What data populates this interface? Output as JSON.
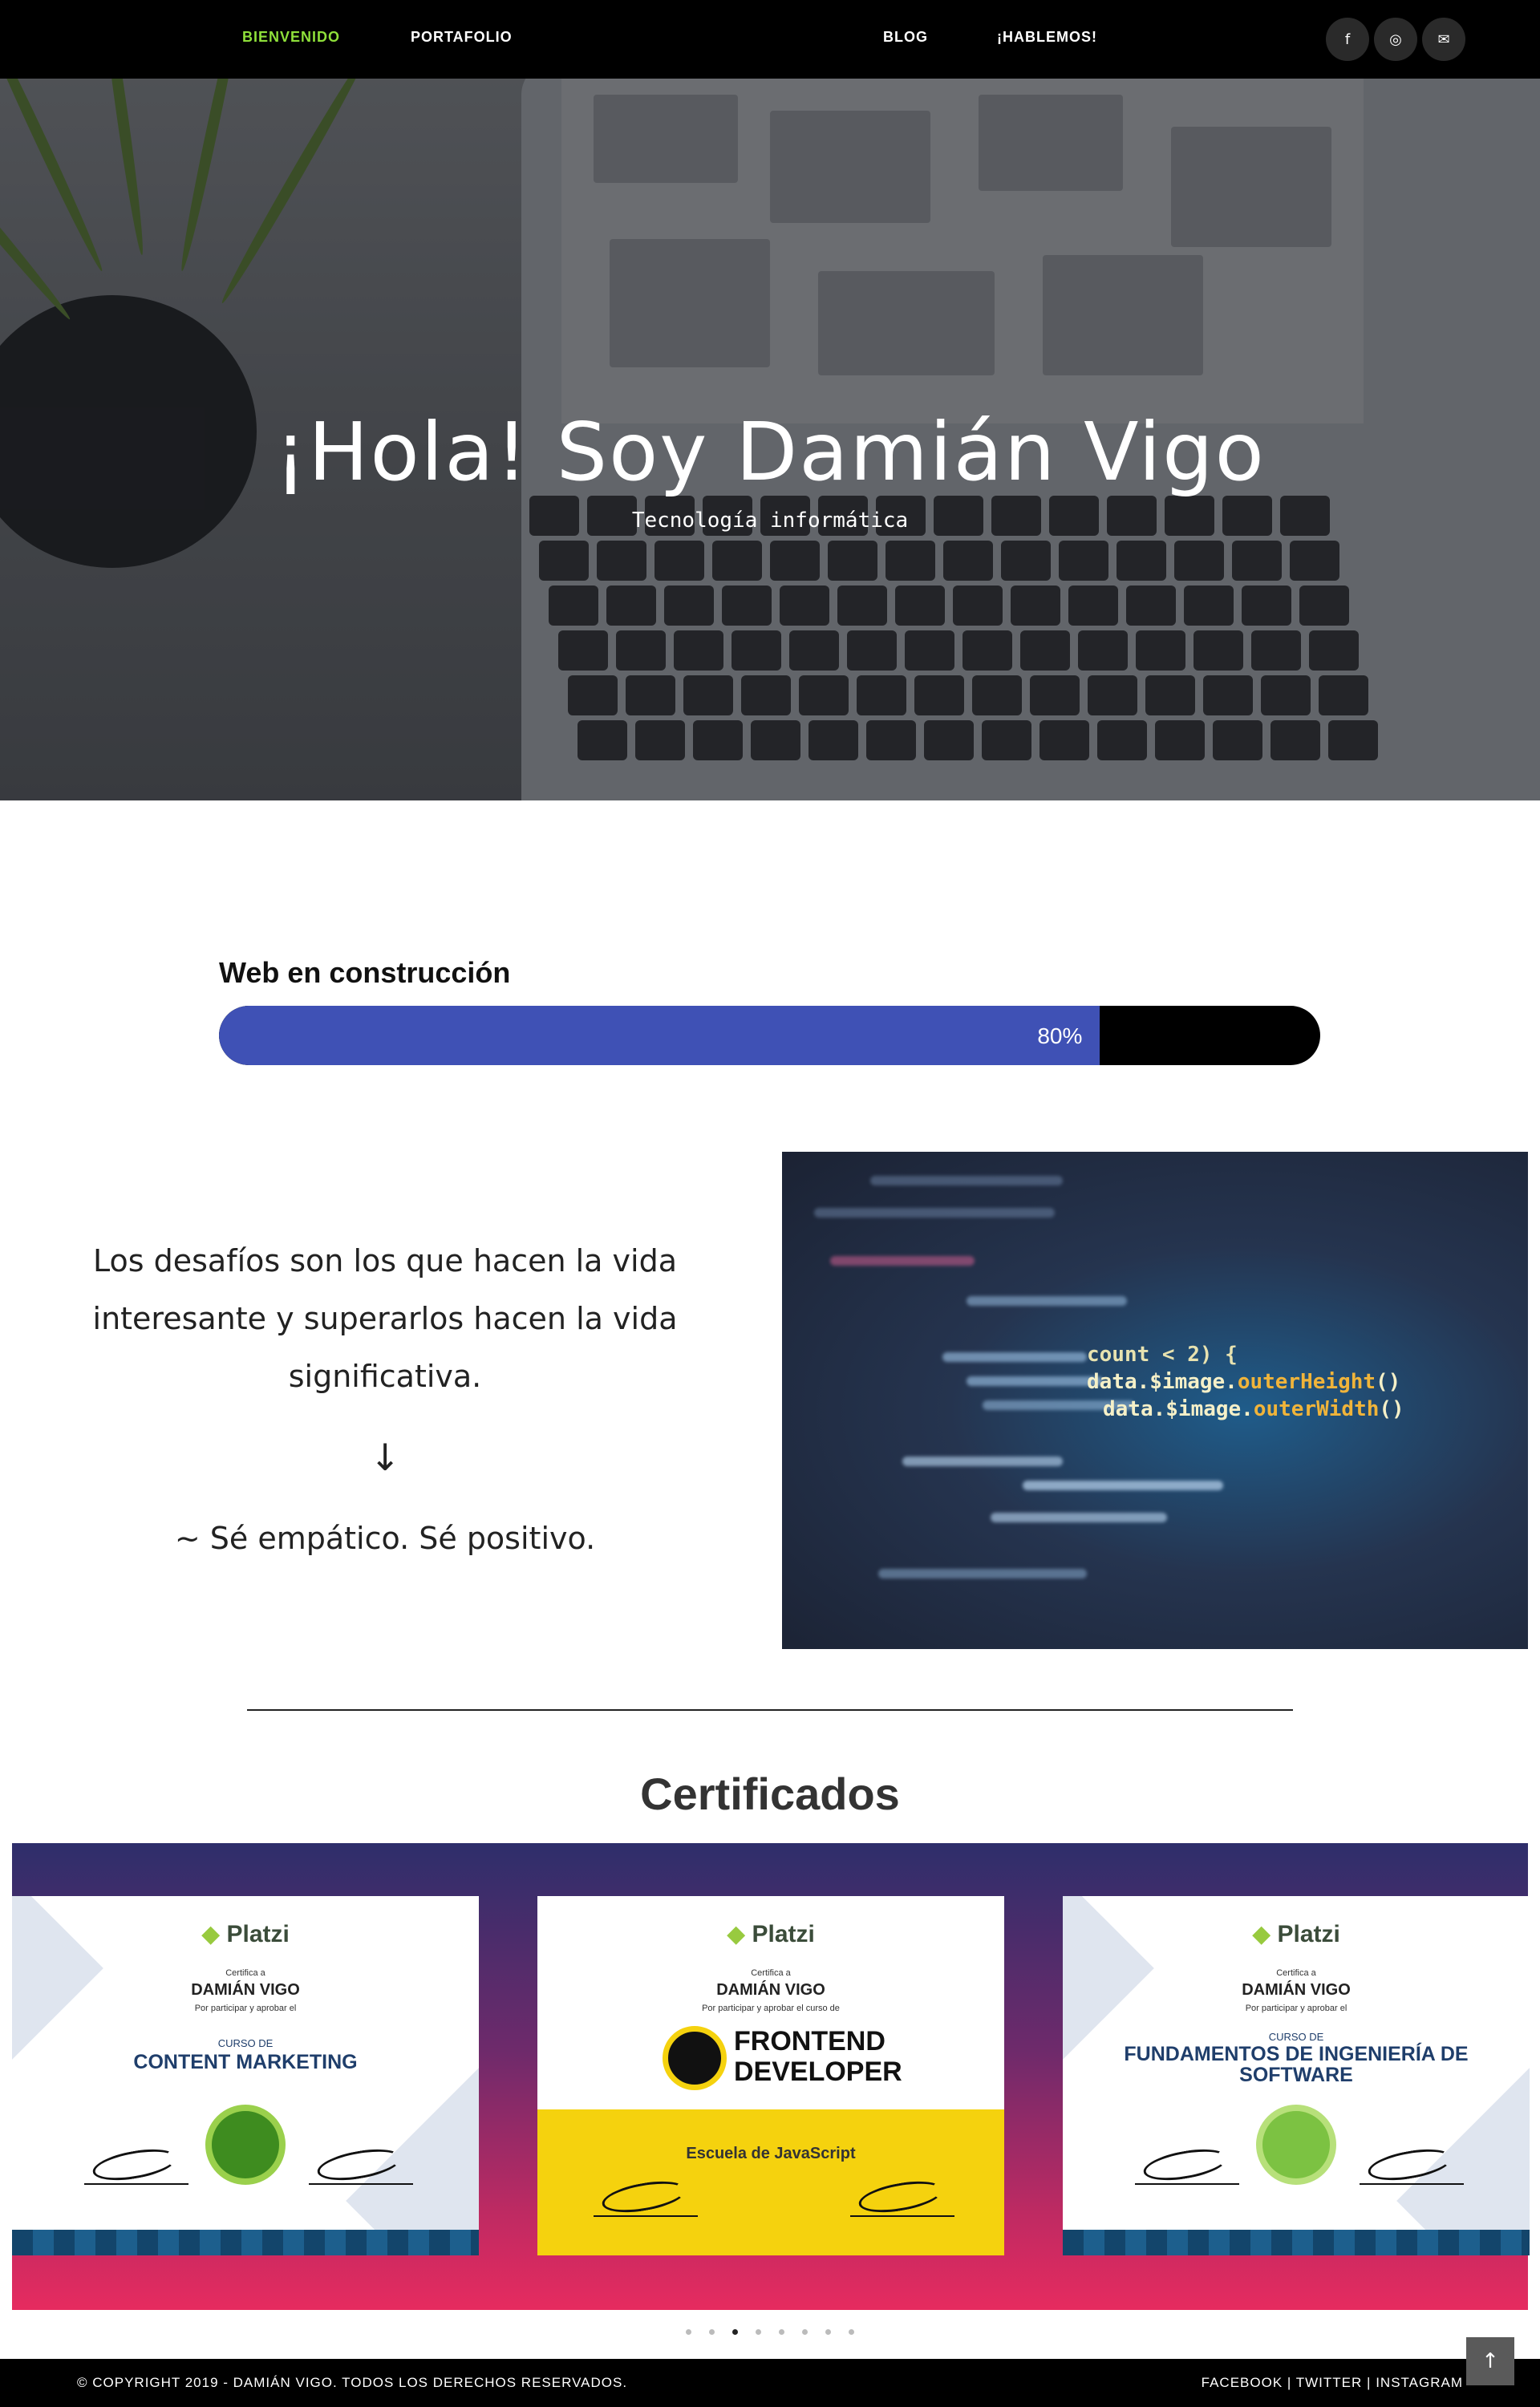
{
  "nav": {
    "items": [
      {
        "label": "BIENVENIDO",
        "active": true
      },
      {
        "label": "PORTAFOLIO",
        "active": false
      },
      {
        "label": "BLOG",
        "active": false
      },
      {
        "label": "¡HABLEMOS!",
        "active": false
      }
    ],
    "social": [
      {
        "icon": "facebook-icon",
        "glyph": "f"
      },
      {
        "icon": "instagram-icon",
        "glyph": "◎"
      },
      {
        "icon": "envelope-icon",
        "glyph": "✉"
      }
    ],
    "active_color": "#8fe03a"
  },
  "hero": {
    "title": "¡Hola! Soy Damián Vigo",
    "subtitle": "Tecnología informática"
  },
  "progress": {
    "label": "Web en construcción",
    "value": 80,
    "value_text": "80%",
    "fill_color": "#3f51b5"
  },
  "quote": {
    "text": "Los desafíos son los que hacen la vida interesante y superarlos hacen la vida significativa.",
    "arrow": "↓",
    "motto": "~ Sé empático. Sé positivo."
  },
  "certificates": {
    "title": "Certificados",
    "items": [
      {
        "issuer": "Platzi",
        "certifica": "Certifica a",
        "name": "DAMIÁN VIGO",
        "reason": "Por participar y aprobar el",
        "course_label": "CURSO DE",
        "course": "CONTENT MARKETING"
      },
      {
        "issuer": "Platzi",
        "certifica": "Certifica a",
        "name": "DAMIÁN VIGO",
        "reason": "Por participar y aprobar el curso de",
        "course": "FRONTEND DEVELOPER",
        "school": "Escuela de JavaScript"
      },
      {
        "issuer": "Platzi",
        "certifica": "Certifica a",
        "name": "DAMIÁN VIGO",
        "reason": "Por participar y aprobar el",
        "course_label": "CURSO DE",
        "course": "FUNDAMENTOS DE INGENIERÍA DE SOFTWARE"
      }
    ],
    "carousel": {
      "dot_count": 8,
      "active_index": 2
    }
  },
  "footer": {
    "copyright": "© COPYRIGHT 2019 - DAMIÁN VIGO. TODOS LOS DERECHOS RESERVADOS.",
    "links": [
      "FACEBOOK",
      "TWITTER",
      "INSTAGRAM"
    ],
    "separator": "|"
  },
  "back_to_top": {
    "glyph": "↑"
  }
}
